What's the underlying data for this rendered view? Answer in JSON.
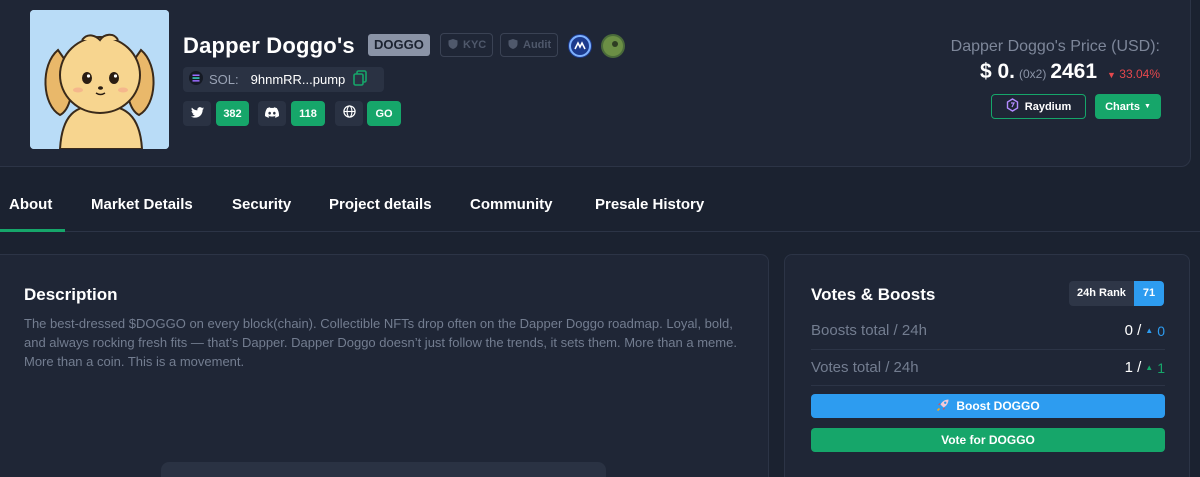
{
  "token": {
    "name": "Dapper Doggo's",
    "ticker": "DOGGO",
    "kyc_label": "KYC",
    "audit_label": "Audit",
    "chain_label": "SOL:",
    "address": "9hnmRR...pump"
  },
  "social": {
    "twitter_count": "382",
    "discord_count": "118",
    "website_label": "GO"
  },
  "price": {
    "label": "Dapper Doggo's Price (USD):",
    "prefix": "$ 0.",
    "zeros": "(0x2)",
    "digits": "2461",
    "change": "33.04%",
    "change_color": "#e5484d"
  },
  "actions": {
    "raydium_label": "Raydium",
    "charts_label": "Charts"
  },
  "tabs": [
    {
      "label": "About",
      "active": true
    },
    {
      "label": "Market Details"
    },
    {
      "label": "Security"
    },
    {
      "label": "Project details"
    },
    {
      "label": "Community"
    },
    {
      "label": "Presale History"
    }
  ],
  "description": {
    "title": "Description",
    "text": "The best-dressed $DOGGO on every block(chain). Collectible NFTs drop often on the Dapper Doggo roadmap. Loyal, bold, and always rocking fresh fits — that’s Dapper. Dapper Doggo doesn’t just follow the trends, it sets them. More than a meme. More than a coin. This is a movement."
  },
  "votes": {
    "title": "Votes & Boosts",
    "rank_label": "24h Rank",
    "rank_value": "71",
    "boosts_label": "Boosts total / 24h",
    "boosts_total": "0 /",
    "boosts_24h": "0",
    "votes_label": "Votes total / 24h",
    "votes_total": "1 /",
    "votes_24h": "1",
    "boost_button": "Boost DOGGO",
    "vote_button": "Vote for DOGGO"
  },
  "colors": {
    "accent_green": "#16a66a",
    "accent_blue": "#2d9cf0",
    "background": "#1b2230"
  }
}
